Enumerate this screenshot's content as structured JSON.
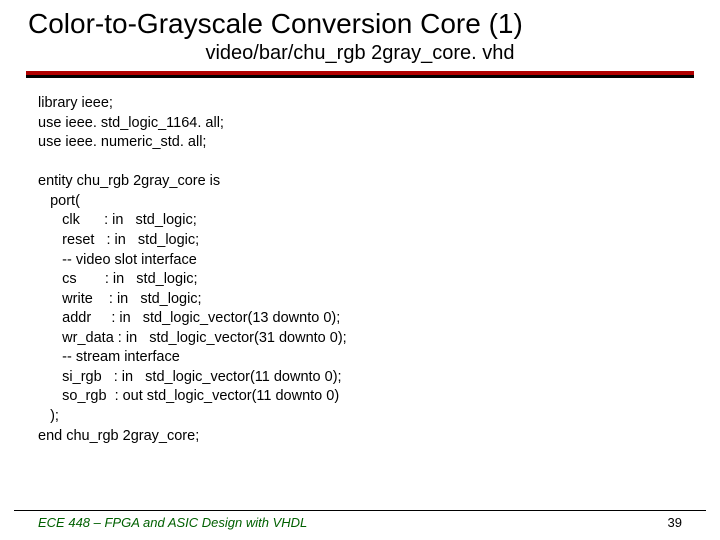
{
  "title": "Color-to-Grayscale Conversion Core (1)",
  "subtitle": "video/bar/chu_rgb 2gray_core. vhd",
  "code": "library ieee;\nuse ieee. std_logic_1164. all;\nuse ieee. numeric_std. all;\n\nentity chu_rgb 2gray_core is\n   port(\n      clk      : in   std_logic;\n      reset   : in   std_logic;\n      -- video slot interface\n      cs       : in   std_logic;\n      write    : in   std_logic;\n      addr     : in   std_logic_vector(13 downto 0);\n      wr_data : in   std_logic_vector(31 downto 0);\n      -- stream interface\n      si_rgb   : in   std_logic_vector(11 downto 0);\n      so_rgb  : out std_logic_vector(11 downto 0)\n   );\nend chu_rgb 2gray_core;",
  "footer": {
    "left": "ECE 448 – FPGA and ASIC Design with VHDL",
    "right": "39"
  }
}
